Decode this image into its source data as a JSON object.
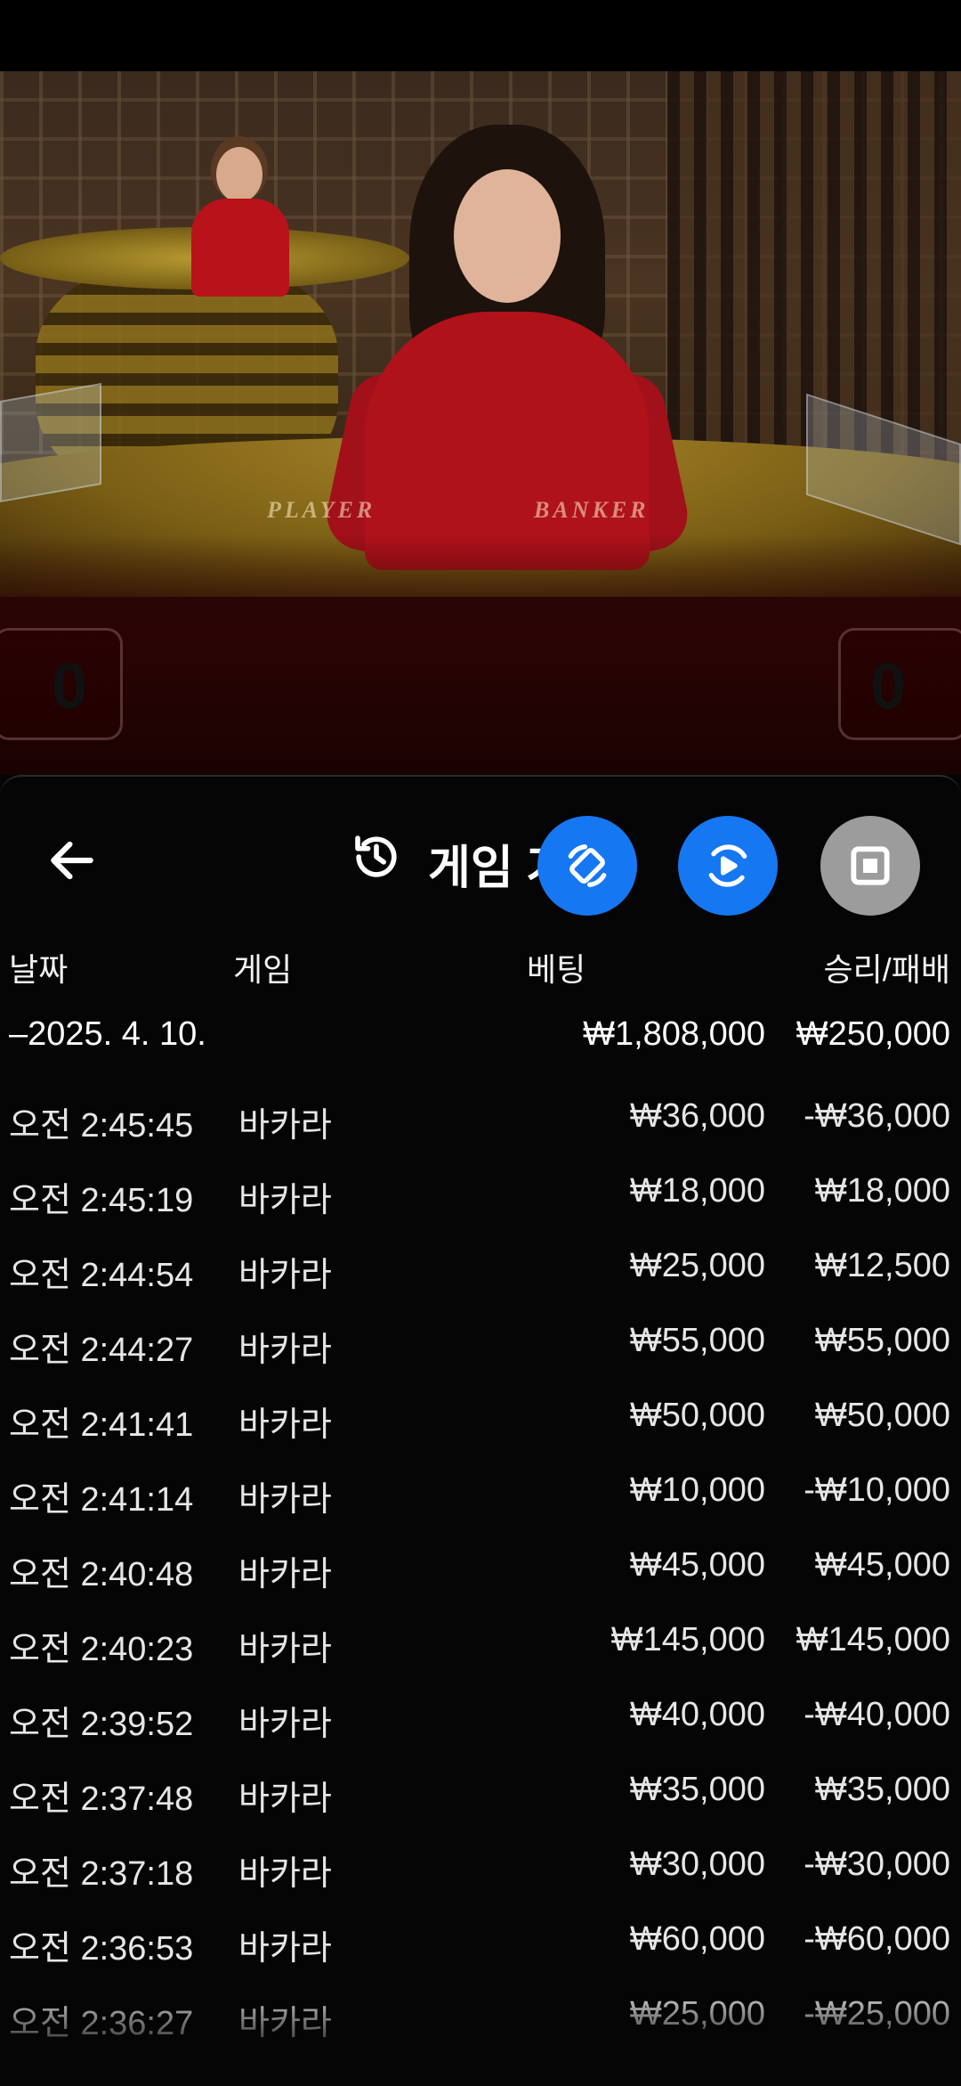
{
  "video": {
    "felt_player": "PLAYER",
    "felt_banker": "BANKER",
    "player_score": "0",
    "banker_score": "0"
  },
  "history": {
    "title": "게임 기록",
    "icons": [
      "back-arrow-icon",
      "history-icon",
      "rotate-screen-icon",
      "video-play-rotate-icon",
      "stop-icon"
    ],
    "columns": {
      "date": "날짜",
      "game": "게임",
      "bet": "베팅",
      "win_loss": "승리/패배"
    },
    "summary": {
      "date": "–2025. 4. 10.",
      "total_bet": "₩1,808,000",
      "total_win": "₩250,000"
    },
    "rows": [
      {
        "time": "오전 2:45:45",
        "game": "바카라",
        "bet": "₩36,000",
        "result": "-₩36,000"
      },
      {
        "time": "오전 2:45:19",
        "game": "바카라",
        "bet": "₩18,000",
        "result": "₩18,000"
      },
      {
        "time": "오전 2:44:54",
        "game": "바카라",
        "bet": "₩25,000",
        "result": "₩12,500"
      },
      {
        "time": "오전 2:44:27",
        "game": "바카라",
        "bet": "₩55,000",
        "result": "₩55,000"
      },
      {
        "time": "오전 2:41:41",
        "game": "바카라",
        "bet": "₩50,000",
        "result": "₩50,000"
      },
      {
        "time": "오전 2:41:14",
        "game": "바카라",
        "bet": "₩10,000",
        "result": "-₩10,000"
      },
      {
        "time": "오전 2:40:48",
        "game": "바카라",
        "bet": "₩45,000",
        "result": "₩45,000"
      },
      {
        "time": "오전 2:40:23",
        "game": "바카라",
        "bet": "₩145,000",
        "result": "₩145,000"
      },
      {
        "time": "오전 2:39:52",
        "game": "바카라",
        "bet": "₩40,000",
        "result": "-₩40,000"
      },
      {
        "time": "오전 2:37:48",
        "game": "바카라",
        "bet": "₩35,000",
        "result": "₩35,000"
      },
      {
        "time": "오전 2:37:18",
        "game": "바카라",
        "bet": "₩30,000",
        "result": "-₩30,000"
      },
      {
        "time": "오전 2:36:53",
        "game": "바카라",
        "bet": "₩60,000",
        "result": "-₩60,000"
      },
      {
        "time": "오전 2:36:27",
        "game": "바카라",
        "bet": "₩25,000",
        "result": "-₩25,000"
      }
    ]
  },
  "colors": {
    "accent_blue": "#1677f2",
    "stop_gray": "#9c9c9c",
    "background": "#050505"
  }
}
